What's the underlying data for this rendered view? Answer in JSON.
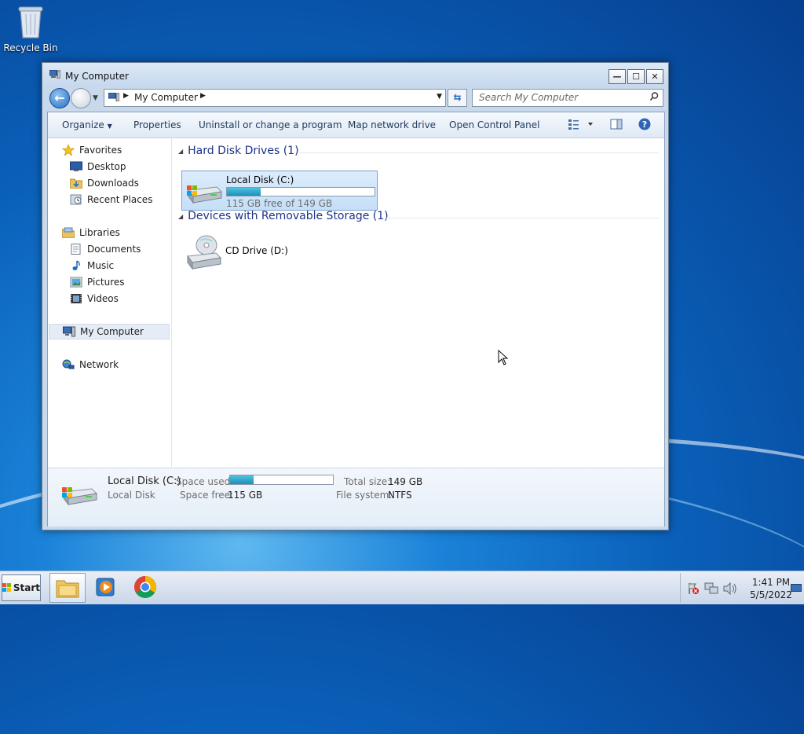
{
  "desktop": {
    "recycle_bin_label": "Recycle Bin"
  },
  "window": {
    "title": "My Computer",
    "controls": {
      "minimize": "—",
      "maximize": "☐",
      "close": "✕"
    }
  },
  "address_bar": {
    "path": "My Computer",
    "search_placeholder": "Search My Computer"
  },
  "command_bar": {
    "organize": "Organize",
    "properties": "Properties",
    "uninstall": "Uninstall or change a program",
    "map_drive": "Map network drive",
    "control_panel": "Open Control Panel"
  },
  "nav_pane": {
    "favorites": "Favorites",
    "desktop": "Desktop",
    "downloads": "Downloads",
    "recent_places": "Recent Places",
    "libraries": "Libraries",
    "documents": "Documents",
    "music": "Music",
    "pictures": "Pictures",
    "videos": "Videos",
    "my_computer": "My Computer",
    "network": "Network"
  },
  "content": {
    "hard_disk_group": "Hard Disk Drives (1)",
    "removable_group": "Devices with Removable Storage (1)",
    "local_disk": {
      "name": "Local Disk (C:)",
      "free_text": "115 GB free of 149 GB",
      "used_fraction": 0.23
    },
    "cd_drive": {
      "name": "CD Drive (D:)"
    }
  },
  "details_pane": {
    "name": "Local Disk (C:)",
    "type": "Local Disk",
    "space_used_label": "Space used:",
    "space_free_label": "Space free:",
    "space_free": "115 GB",
    "total_size_label": "Total size:",
    "total_size": "149 GB",
    "file_system_label": "File system:",
    "file_system": "NTFS",
    "used_fraction": 0.23
  },
  "taskbar": {
    "start_label": "Start",
    "time": "1:41 PM",
    "date": "5/5/2022"
  }
}
